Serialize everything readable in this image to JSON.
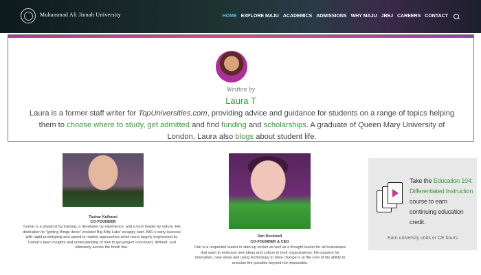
{
  "header": {
    "university_name": "Muhammad Ali Jinnah University",
    "tagline": "",
    "nav": [
      "HOME",
      "EXPLORE MAJU",
      "ACADEMICS",
      "ADMISSIONS",
      "WHY MAJU",
      "JBEJ",
      "CAREERS",
      "CONTACT"
    ],
    "active_nav": "HOME",
    "search_icon": "search-icon",
    "accent_color": "#4ec3e0"
  },
  "author": {
    "written_by": "Written by",
    "name": "Laura T",
    "bio": {
      "p1": "Laura is a former staff writer for ",
      "site": "TopUniversities.com",
      "p2": ", providing advice and guidance for students on a range of topics helping them to ",
      "link1": "choose where to study",
      "p3": ", ",
      "link2": "get admitted",
      "p4": " and find ",
      "link3": "funding",
      "p5": " and ",
      "link4": "scholarships",
      "p6": ". A graduate of Queen Mary University of London, Laura also ",
      "link5": "blogs",
      "p7": " about student life."
    },
    "link_color": "#3a9a3a"
  },
  "founders": [
    {
      "name": "Tushar Kulkarni",
      "role": "CO-FOUNDER",
      "desc": "Tushar is a physicist by training, a developer by experience, and a born leader by nature. His dedication to \"getting things done\" enabled Big Kitty Labs' scrappy start. BKL's early success with rapid prototyping and speed to market approaches which were largely engineered by Tushar's keen insights and understanding of how to get project conceived, defined, and ultimately across the finish line."
    },
    {
      "name": "Dan Rockwell",
      "role": "CO-FOUNDER & CEO",
      "desc": "Dan is a respected leader in start-up circles as well as a thought leader for all businesses that want to embrace new ideas and culture in their organizations. His passion for innovation, new ideas and using technology to drive change is at the core of his ability to envision the possible beyond the impossible."
    }
  ],
  "promo": {
    "line_a": "Take the ",
    "highlight": "Education 104: Differentiated Instruction",
    "line_b": " course to earn continuing education credit.",
    "footer": "Earn university units or CE hours",
    "icon": "video-cards-icon"
  }
}
